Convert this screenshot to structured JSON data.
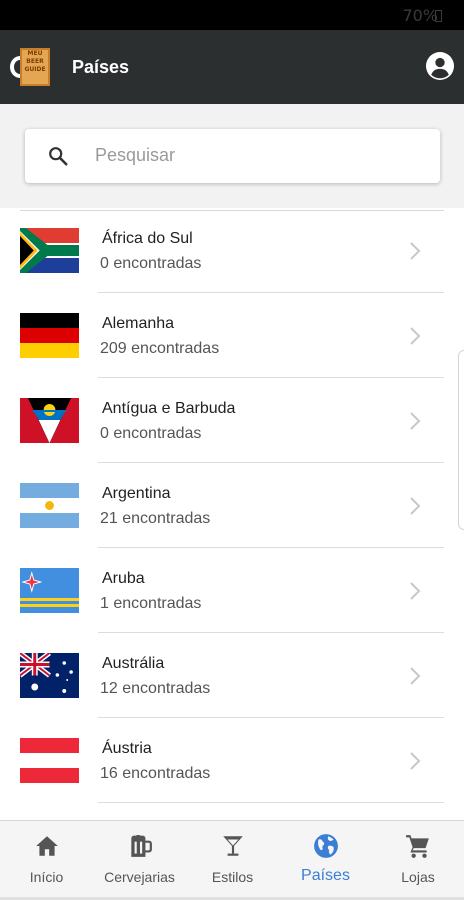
{
  "status_bar": {
    "battery": "70%"
  },
  "app_bar": {
    "title": "Países",
    "logo_text": [
      "MEU",
      "BEER",
      "GUIDE"
    ]
  },
  "search": {
    "placeholder": "Pesquisar"
  },
  "countries": [
    {
      "name": "África do Sul",
      "count": "0 encontradas",
      "flag": "south-africa"
    },
    {
      "name": "Alemanha",
      "count": "209 encontradas",
      "flag": "germany"
    },
    {
      "name": "Antígua e Barbuda",
      "count": "0 encontradas",
      "flag": "antigua-barbuda"
    },
    {
      "name": "Argentina",
      "count": "21 encontradas",
      "flag": "argentina"
    },
    {
      "name": "Aruba",
      "count": "1 encontradas",
      "flag": "aruba"
    },
    {
      "name": "Austrália",
      "count": "12 encontradas",
      "flag": "australia"
    },
    {
      "name": "Áustria",
      "count": "16 encontradas",
      "flag": "austria"
    }
  ],
  "bottom_nav": [
    {
      "label": "Início",
      "icon": "home-icon"
    },
    {
      "label": "Cervejarias",
      "icon": "beer-mug-icon"
    },
    {
      "label": "Estilos",
      "icon": "cocktail-glass-icon"
    },
    {
      "label": "Países",
      "icon": "globe-icon",
      "active": true
    },
    {
      "label": "Lojas",
      "icon": "shopping-cart-icon"
    }
  ],
  "colors": {
    "app_bar": "#2b2f30",
    "accent": "#3b7fd4",
    "nav_bg": "#f5f5f5"
  }
}
